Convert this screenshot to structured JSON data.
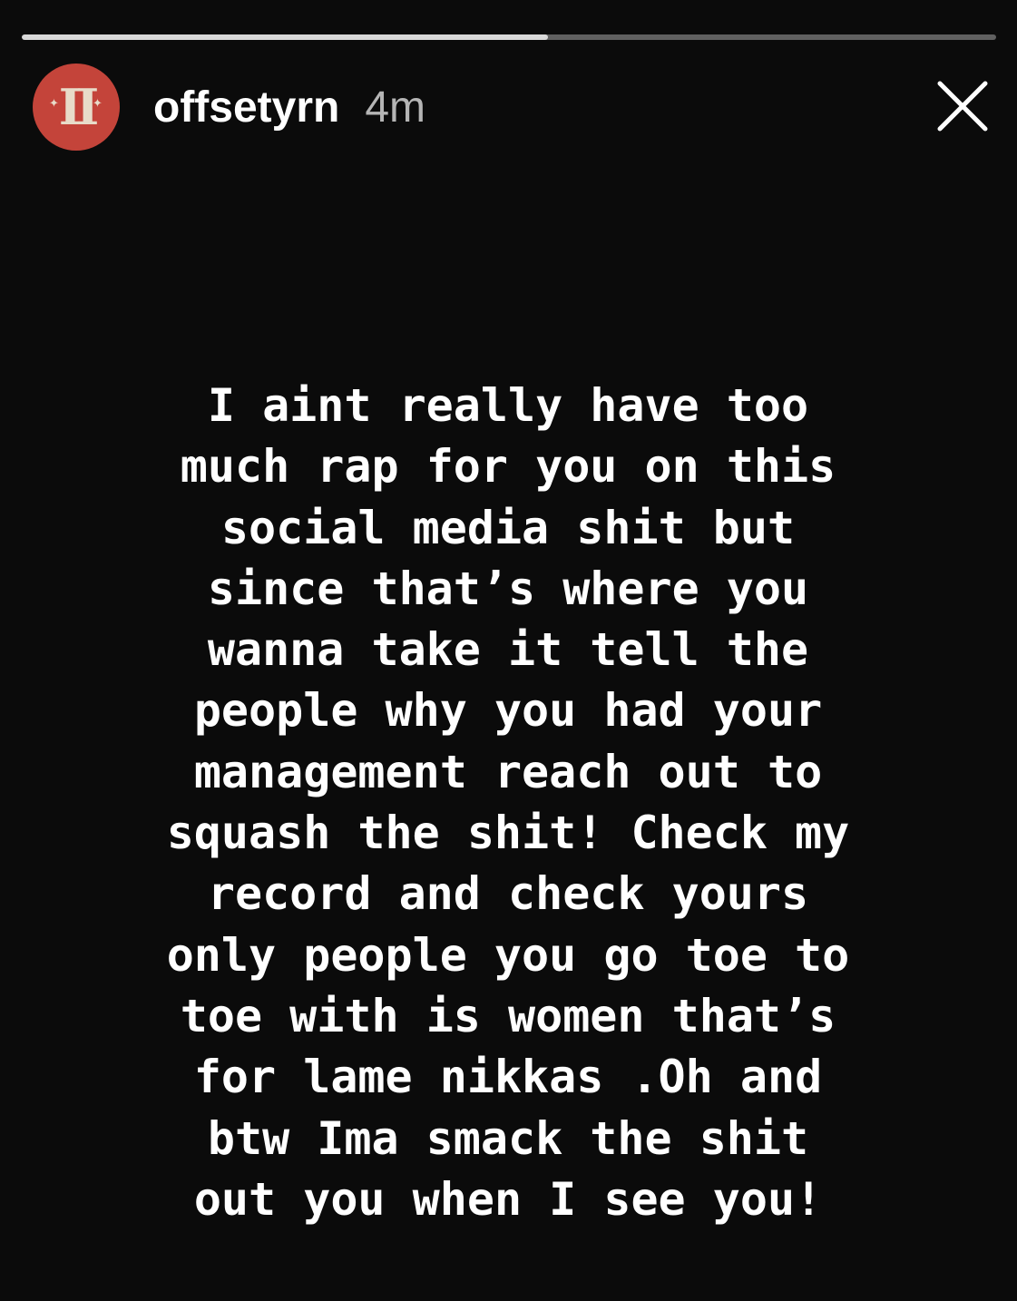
{
  "story": {
    "progress": 0.54,
    "user": {
      "username": "offsetyrn",
      "timestamp": "4m",
      "avatar_color": "#c4443a"
    },
    "message_lines": [
      "I aint really have too",
      "much rap for you on this",
      "social media shit but",
      "since that’s where you",
      "wanna take it tell the",
      "people why you had your",
      "management reach out to",
      "squash the shit! Check my",
      "record and check yours",
      "only people you go toe to",
      "toe with is women that’s",
      "for lame nikkas .Oh and",
      "btw Ima smack the shit",
      "out you when I see you!"
    ]
  },
  "icons": {
    "close": "close-icon",
    "avatar": "avatar-logo-icon"
  },
  "colors": {
    "background": "#0b0b0b",
    "text": "#ffffff",
    "timestamp": "#b5b5b5"
  }
}
